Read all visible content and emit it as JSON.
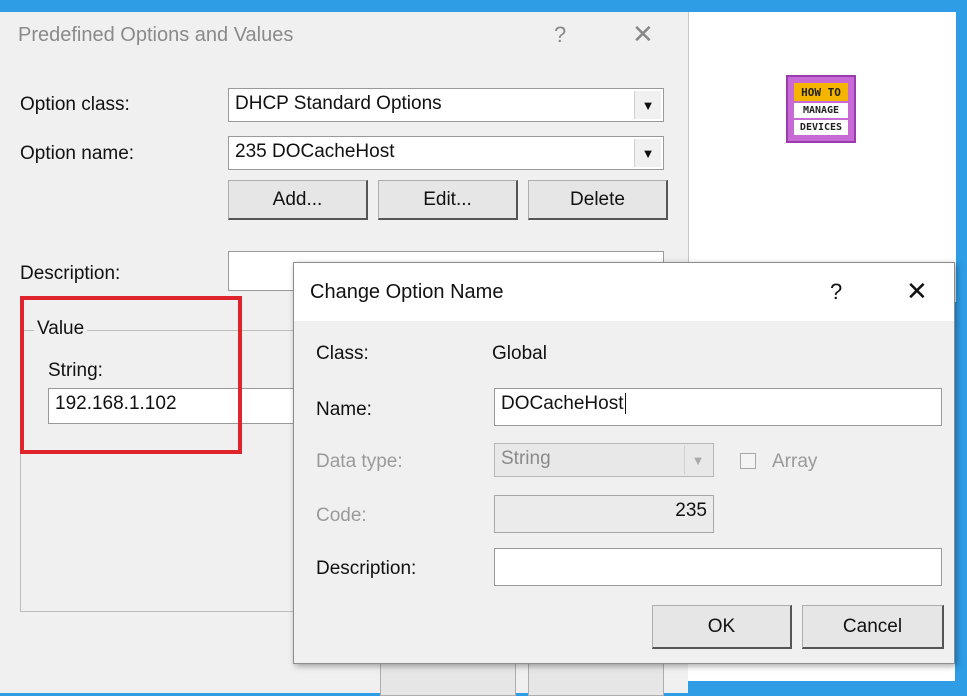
{
  "back_dialog": {
    "title": "Predefined Options and Values",
    "help_icon": "?",
    "close_icon": "✕",
    "option_class_label": "Option class:",
    "option_class_value": "DHCP Standard Options",
    "option_name_label": "Option name:",
    "option_name_value": "235 DOCacheHost",
    "add_label": "Add...",
    "edit_label": "Edit...",
    "delete_label": "Delete",
    "description_label": "Description:",
    "value_group_label": "Value",
    "string_label": "String:",
    "string_value": "192.168.1.102"
  },
  "front_dialog": {
    "title": "Change Option Name",
    "help_icon": "?",
    "close_icon": "✕",
    "class_label": "Class:",
    "class_value": "Global",
    "name_label": "Name:",
    "name_value": "DOCacheHost",
    "data_type_label": "Data type:",
    "data_type_value": "String",
    "array_label": "Array",
    "code_label": "Code:",
    "code_value": "235",
    "description_label": "Description:",
    "description_value": "",
    "ok_label": "OK",
    "cancel_label": "Cancel"
  },
  "logo": {
    "line1": "HOW TO",
    "line2": "MANAGE",
    "line3": "DEVICES"
  },
  "colors": {
    "frame": "#2f9ce6",
    "highlight": "#e0242c",
    "logo_purple": "#c86ad6",
    "logo_orange": "#f5b400"
  }
}
